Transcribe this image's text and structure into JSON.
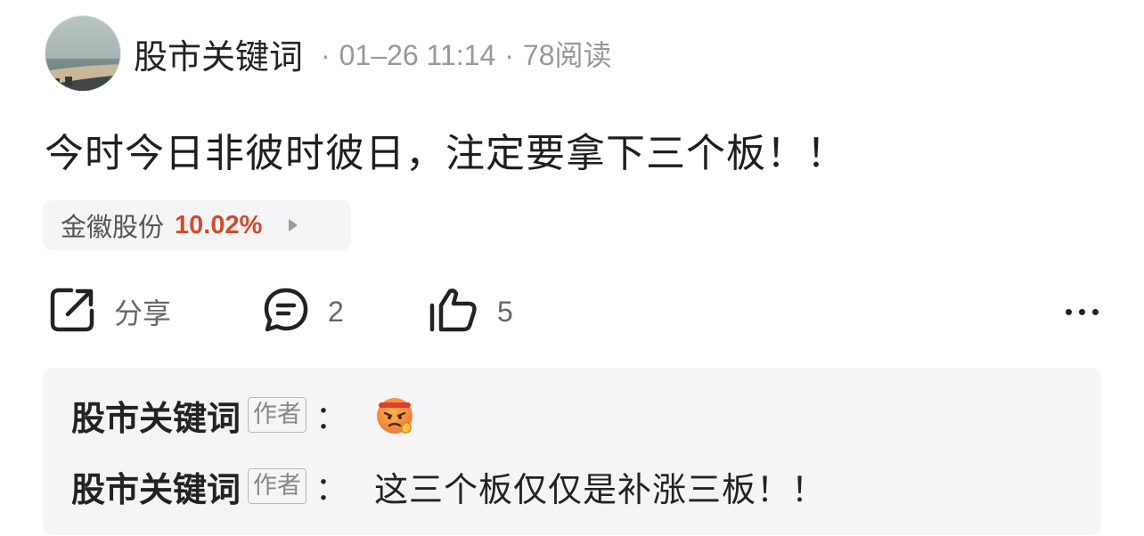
{
  "post": {
    "author": "股市关键词",
    "date": "01–26 11:14",
    "views": "78阅读",
    "separator": "·",
    "text": "今时今日非彼时彼日，注定要拿下三个板！！"
  },
  "stock": {
    "name": "金徽股份",
    "change": "10.02%",
    "change_color": "#cf4b2b"
  },
  "actions": {
    "share_label": "分享",
    "share_icon": "share-icon",
    "comment_count": "2",
    "comment_icon": "comment-icon",
    "like_count": "5",
    "like_icon": "thumbs-up-icon",
    "more_icon": "more-dots-icon"
  },
  "comments": [
    {
      "author": "股市关键词",
      "badge": "作者",
      "colon": "：",
      "text": "",
      "emoji": "angry-face-emoji"
    },
    {
      "author": "股市关键词",
      "badge": "作者",
      "colon": "：",
      "text": "这三个板仅仅是补涨三板！！"
    }
  ]
}
